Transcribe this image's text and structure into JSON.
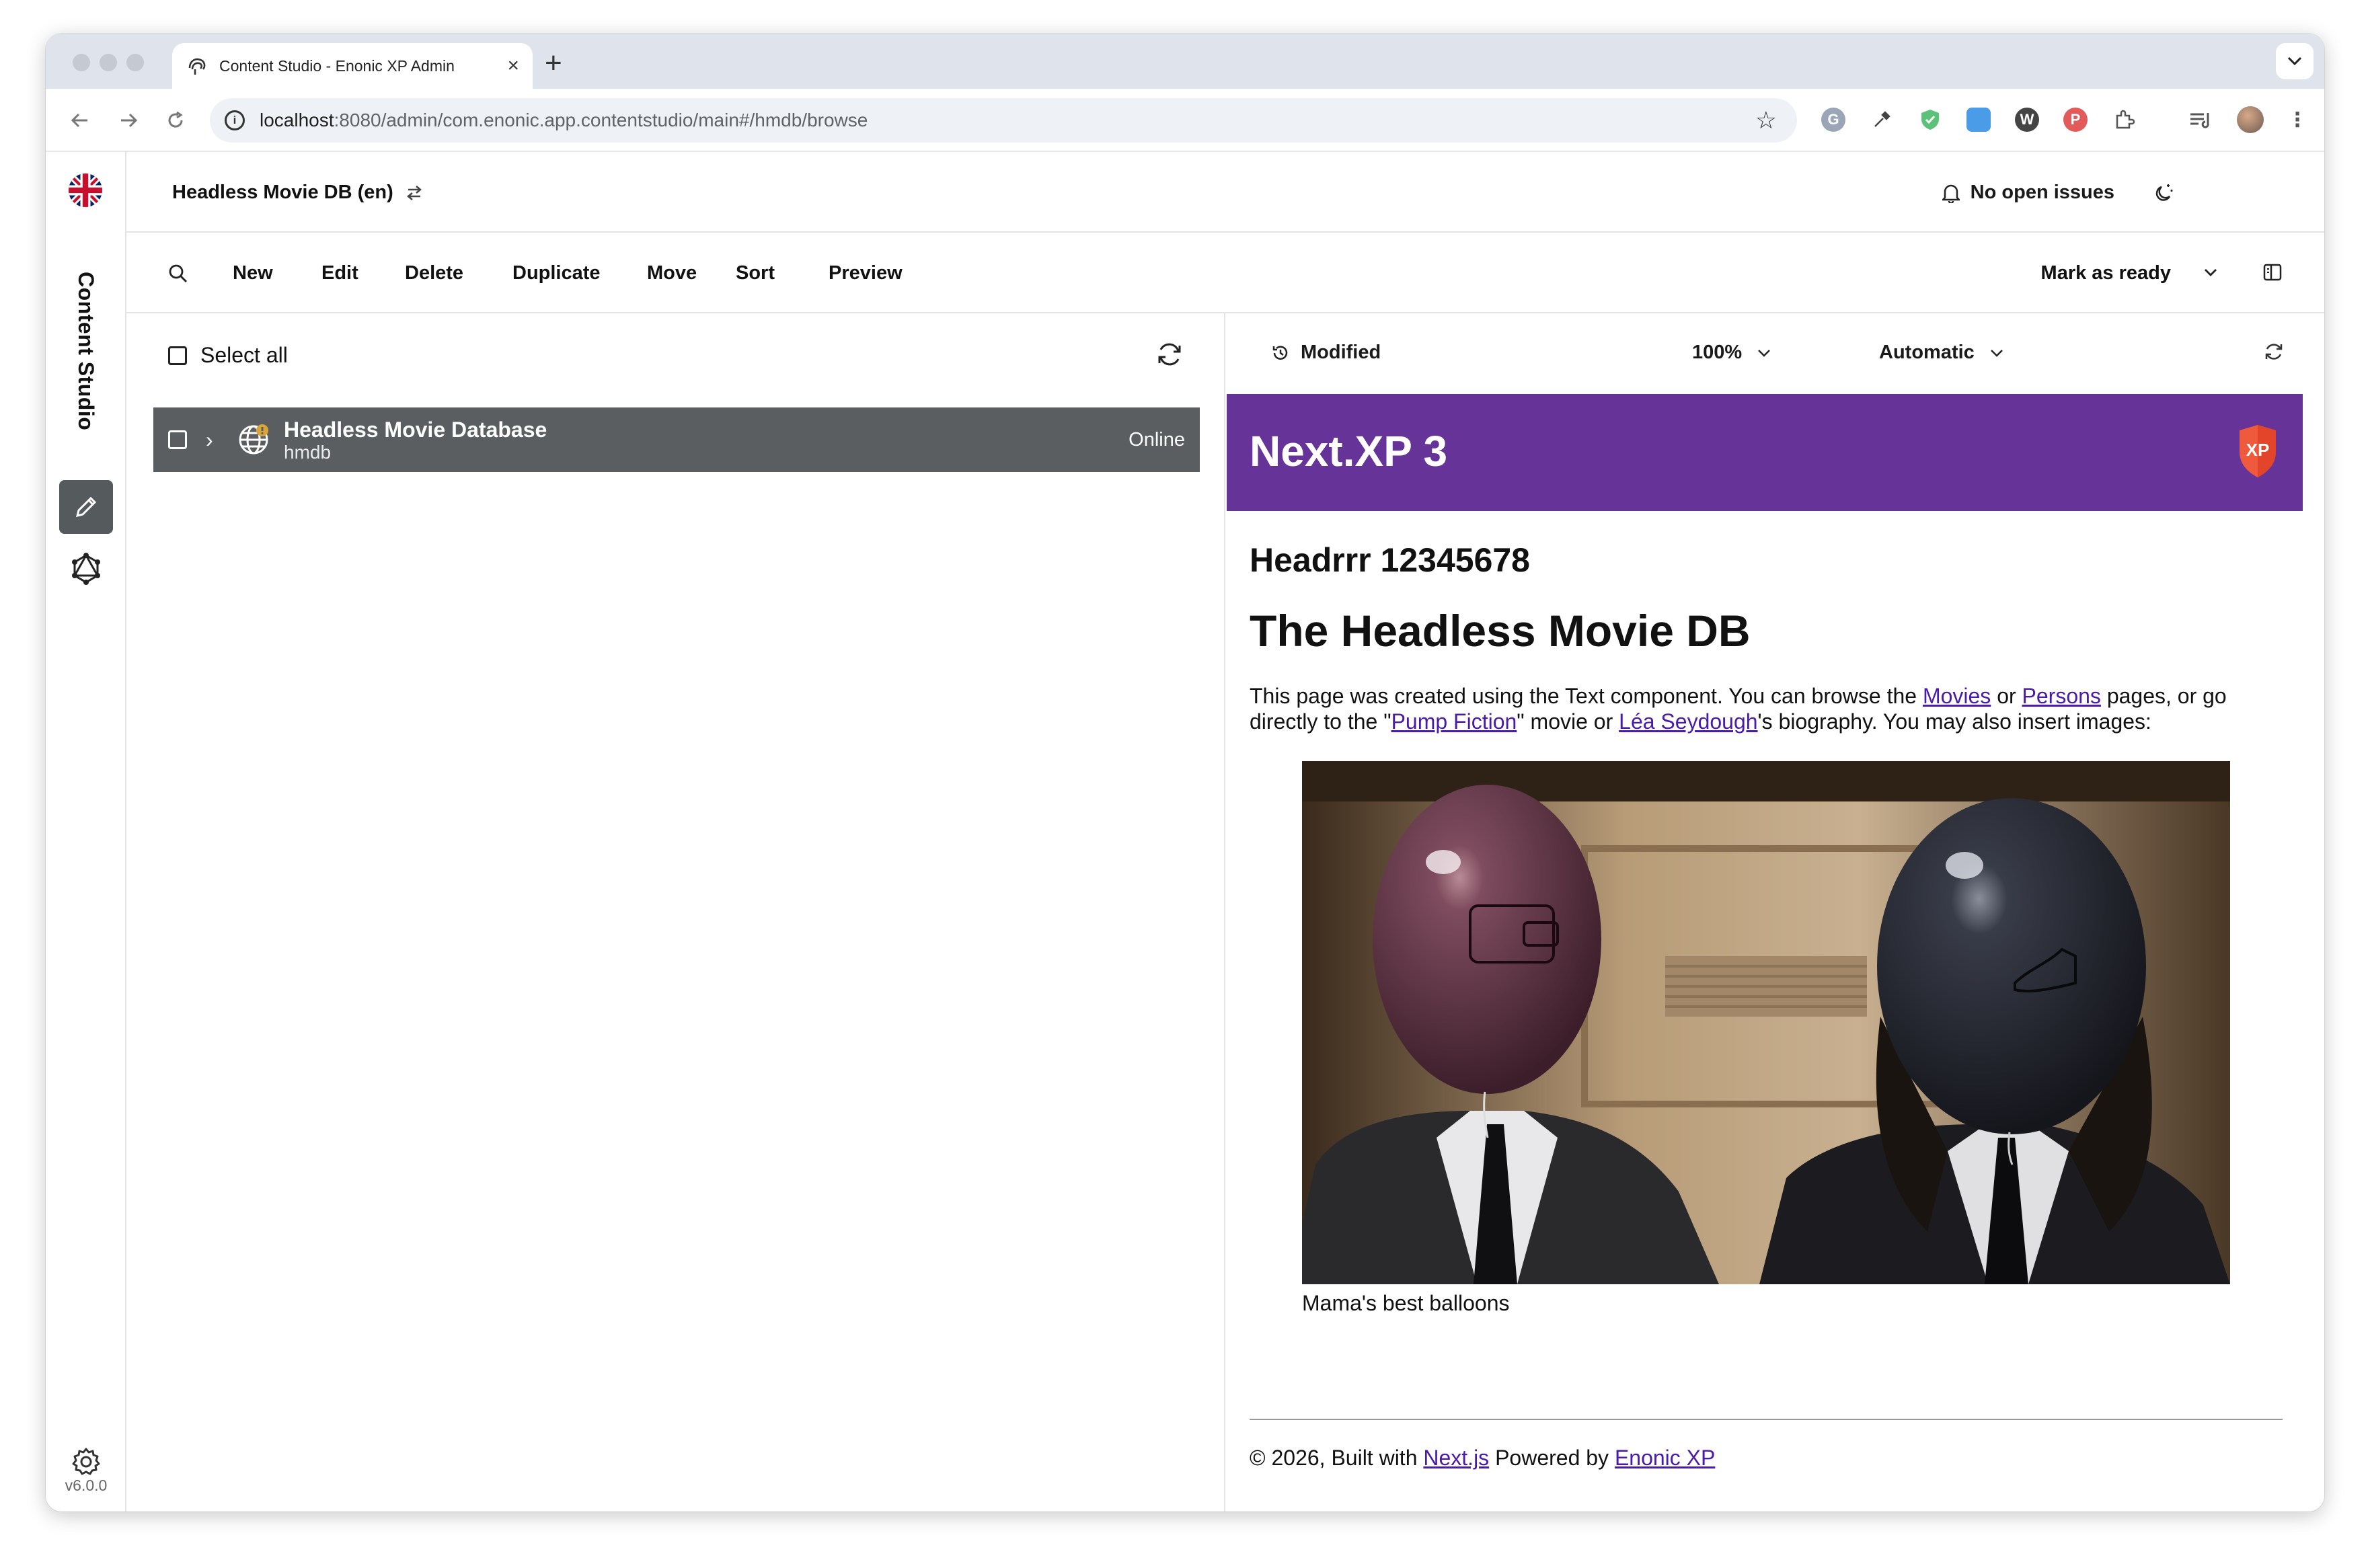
{
  "browser": {
    "tab_title": "Content Studio - Enonic XP Admin",
    "url_host": "localhost",
    "url_path": ":8080/admin/com.enonic.app.contentstudio/main#/hmdb/browse",
    "new_tab_label": "+",
    "close_tab_label": "×"
  },
  "rail": {
    "app_name": "Content Studio",
    "version": "v6.0.0"
  },
  "topbar": {
    "project": "Headless Movie DB (en)",
    "issues": "No open issues"
  },
  "toolbar": {
    "new": "New",
    "edit": "Edit",
    "delete": "Delete",
    "duplicate": "Duplicate",
    "move": "Move",
    "sort": "Sort",
    "preview": "Preview",
    "mark_as_ready": "Mark as ready"
  },
  "browse": {
    "select_all": "Select all",
    "rows": [
      {
        "display_name": "Headless Movie Database",
        "path": "hmdb",
        "status": "Online"
      }
    ]
  },
  "preview": {
    "status": "Modified",
    "zoom": "100%",
    "mode": "Automatic"
  },
  "site": {
    "title": "Next.XP 3",
    "logo_text": "XP",
    "subheading": "Headrrr 12345678",
    "heading": "The Headless Movie DB",
    "intro": {
      "p1": "This page was created using the Text component. You can browse the ",
      "link_movies": "Movies",
      "p2": " or ",
      "link_persons": "Persons",
      "p3": " pages, or go directly to the \"",
      "link_pump": "Pump Fiction",
      "p4": "\" movie or ",
      "link_lea": "Léa Seydough",
      "p5": "'s biography. You may also insert images:"
    },
    "caption": "Mama's best balloons",
    "footer": {
      "f1": "© 2026, Built with ",
      "link_next": "Next.js",
      "f2": " Powered by ",
      "link_enonic": "Enonic XP"
    }
  },
  "colors": {
    "site_header": "#663399",
    "selected_row": "#5b5e60",
    "link": "#4a1aa8"
  }
}
